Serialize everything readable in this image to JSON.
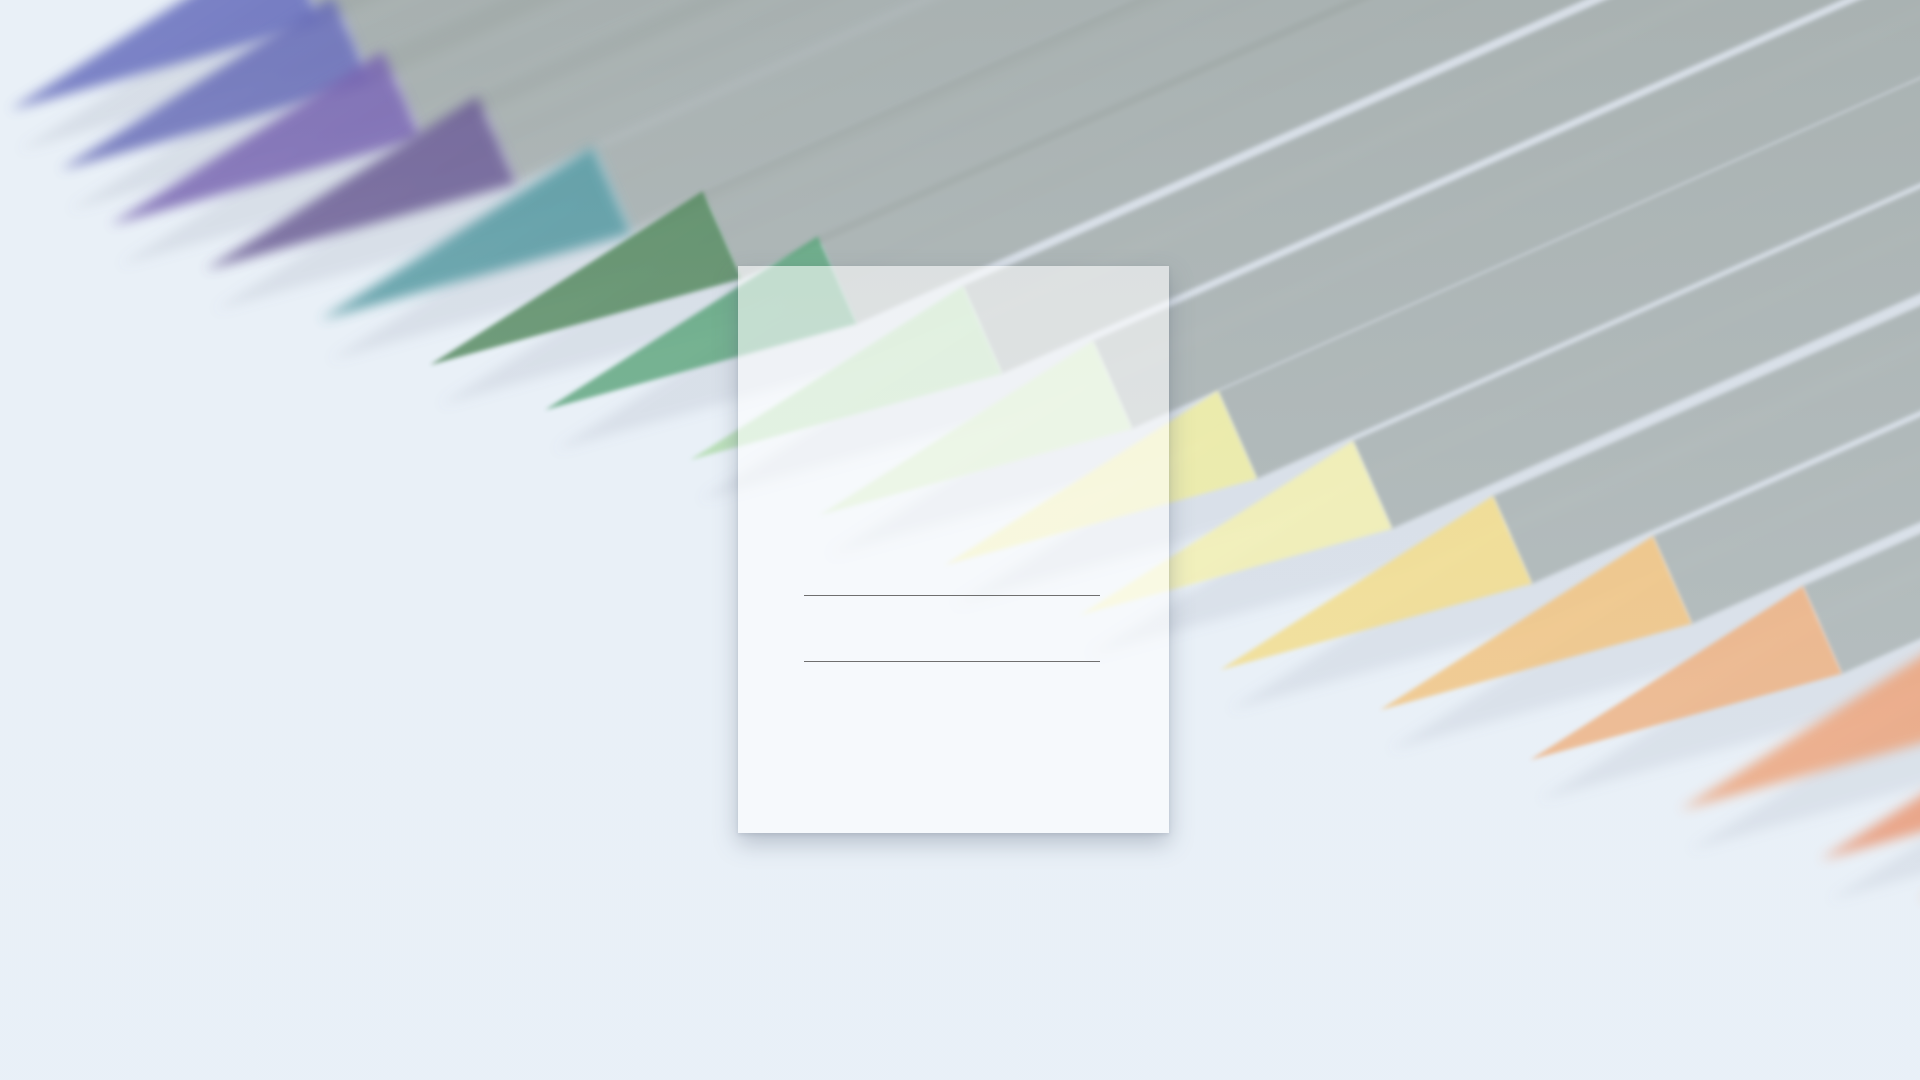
{
  "scene": {
    "description_icon": "colored-pencils-photo",
    "background_color": "#e8f0f8",
    "pencil_colors": [
      "#5b64b8",
      "#5a5fb0",
      "#6a55a8",
      "#5a4a86",
      "#3f8c94",
      "#3f7a48",
      "#4a9a6a",
      "#a8d8a0",
      "#c8e6b0",
      "#f0ec90",
      "#f6f0a0",
      "#f6d870",
      "#f4b860",
      "#f0a060",
      "#ee8c55",
      "#ea7a48",
      "#e66a40"
    ],
    "body_color": "#9aa3a0"
  },
  "card": {
    "line1_text": "",
    "line2_text": ""
  }
}
